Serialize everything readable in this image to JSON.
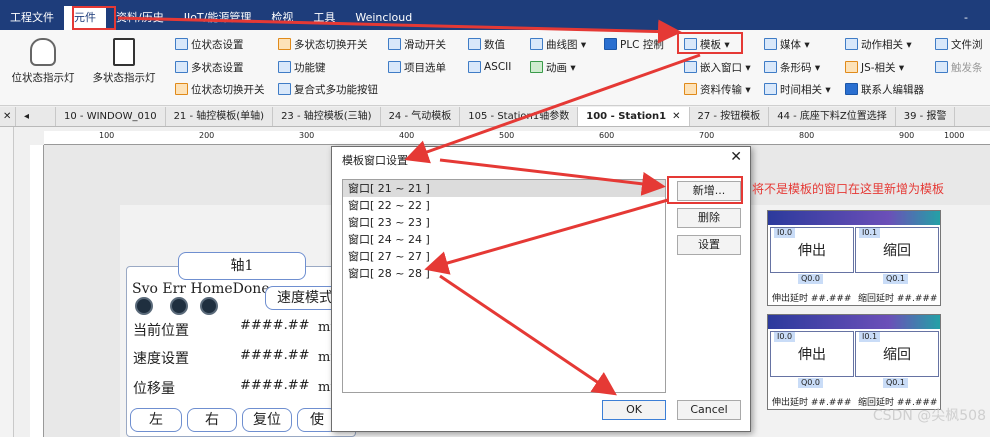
{
  "menu": [
    "工程文件",
    "元件",
    "资料/历史",
    "IIoT/能源管理",
    "检视",
    "工具",
    "Weincloud"
  ],
  "menu_right": "-",
  "ribbon": {
    "big": [
      "位状态指示灯",
      "多状态指示灯"
    ],
    "col1": [
      "位状态设置",
      "多状态设置",
      "位状态切换开关"
    ],
    "col2": [
      "多状态切换开关",
      "功能键",
      "复合式多功能按钮"
    ],
    "col3": [
      "滑动开关",
      "项目选单"
    ],
    "col4": [
      "数值",
      "ASCII"
    ],
    "col5": [
      "曲线图 ▾",
      "动画 ▾"
    ],
    "col6": [
      "PLC 控制"
    ],
    "col7": [
      "模板 ▾",
      "嵌入窗口 ▾",
      "资料传输 ▾"
    ],
    "col8": [
      "媒体 ▾",
      "条形码 ▾",
      "时间相关 ▾"
    ],
    "col9": [
      "动作相关 ▾",
      "JS-相关 ▾",
      "联系人编辑器"
    ],
    "col10": [
      "文件浏",
      "触发条"
    ]
  },
  "tabs": [
    "10 - WINDOW_010",
    "21 - 轴控模板(单轴)",
    "23 - 轴控模板(三轴)",
    "24 - 气动模板",
    "105 - Station1轴参数",
    "100 - Station1",
    "27 - 按钮模板",
    "44 - 底座下料Z位置选择",
    "39 - 报警"
  ],
  "tabs_active_index": 5,
  "ruler_labels": [
    "100",
    "200",
    "300",
    "400",
    "500",
    "600",
    "700",
    "800",
    "900",
    "1000"
  ],
  "axis": {
    "title": "轴1",
    "status": [
      "Svo",
      "Err",
      "HomeDone"
    ],
    "mode_button": "速度模式",
    "rows": [
      {
        "label": "当前位置",
        "value": "####.##",
        "unit": "mm"
      },
      {
        "label": "速度设置",
        "value": "####.##",
        "unit": "mm"
      },
      {
        "label": "位移量",
        "value": "####.##",
        "unit": "mm"
      }
    ],
    "buttons": [
      "左",
      "右",
      "复位",
      "使"
    ]
  },
  "templates": [
    {
      "tags": [
        "I0.0",
        "I0.1"
      ],
      "cells": [
        "伸出",
        "缩回"
      ],
      "q": [
        "Q0.0",
        "Q0.1"
      ],
      "foot": [
        "伸出延时",
        "##.###",
        "缩回延时",
        "##.###"
      ]
    },
    {
      "tags": [
        "I0.0",
        "I0.1"
      ],
      "cells": [
        "伸出",
        "缩回"
      ],
      "q": [
        "Q0.0",
        "Q0.1"
      ],
      "foot": [
        "伸出延时",
        "##.###",
        "缩回延时",
        "##.###"
      ]
    }
  ],
  "dialog": {
    "title": "模板窗口设置",
    "close": "✕",
    "items": [
      "窗口[ 21 ~ 21 ]",
      "窗口[ 22 ~ 22 ]",
      "窗口[ 23 ~ 23 ]",
      "窗口[ 24 ~ 24 ]",
      "窗口[ 27 ~ 27 ]",
      "窗口[ 28 ~ 28 ]"
    ],
    "selected_index": 0,
    "buttons": {
      "add": "新增...",
      "delete": "删除",
      "settings": "设置",
      "ok": "OK",
      "cancel": "Cancel"
    }
  },
  "annotation": "将不是模板的窗口在这里新增为模板",
  "watermark": "CSDN @尖枫508",
  "colors": {
    "menu_bg": "#1e3d7b",
    "highlight": "#e53935"
  }
}
